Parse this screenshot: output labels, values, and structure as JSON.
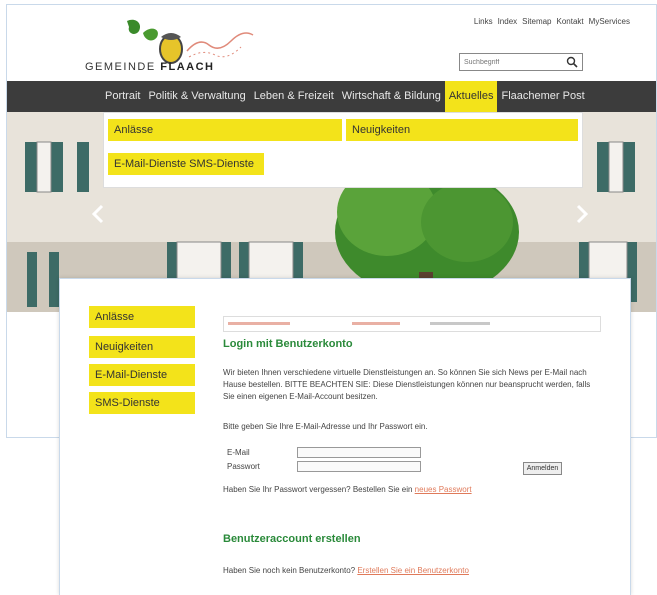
{
  "header": {
    "logo_text_a": "GEMEINDE",
    "logo_text_b": "FLAACH",
    "top_links": [
      "Links",
      "Index",
      "Sitemap",
      "Kontakt",
      "MyServices"
    ],
    "search_placeholder": "Suchbegriff"
  },
  "nav": {
    "items": [
      "Portrait",
      "Politik & Verwaltung",
      "Leben & Freizeit",
      "Wirtschaft & Bildung",
      "Aktuelles",
      "Flaachemer Post"
    ],
    "active_index": 4
  },
  "dropdown": {
    "items": [
      "Anlässe",
      "Neuigkeiten",
      "E-Mail-Dienste SMS-Dienste"
    ]
  },
  "sidebar": {
    "items": [
      "Anlässe",
      "Neuigkeiten",
      "E-Mail-Dienste",
      "SMS-Dienste"
    ]
  },
  "main": {
    "login_title": "Login mit Benutzerkonto",
    "login_text": "Wir bieten Ihnen verschiedene virtuelle Dienstleistungen an. So können Sie sich News per E-Mail nach Hause bestellen. BITTE BEACHTEN SIE: Diese Dienstleistungen können nur beansprucht werden, falls Sie einen eigenen E-Mail-Account besitzen.",
    "login_prompt": "Bitte geben Sie Ihre E-Mail-Adresse und Ihr Passwort ein.",
    "email_label": "E-Mail",
    "password_label": "Passwort",
    "login_button": "Anmelden",
    "forgot_text": "Haben Sie Ihr Passwort vergessen? Bestellen Sie ein",
    "forgot_link": "neues Passwort",
    "create_title": "Benutzeraccount erstellen",
    "create_text": "Haben Sie noch kein Benutzerkonto?",
    "create_link": "Erstellen Sie ein Benutzerkonto"
  },
  "colors": {
    "accent_yellow": "#f3e31a",
    "nav_bg": "#3c3c3c",
    "title_green": "#2a8a3a",
    "link_orange": "#e07a5a"
  }
}
